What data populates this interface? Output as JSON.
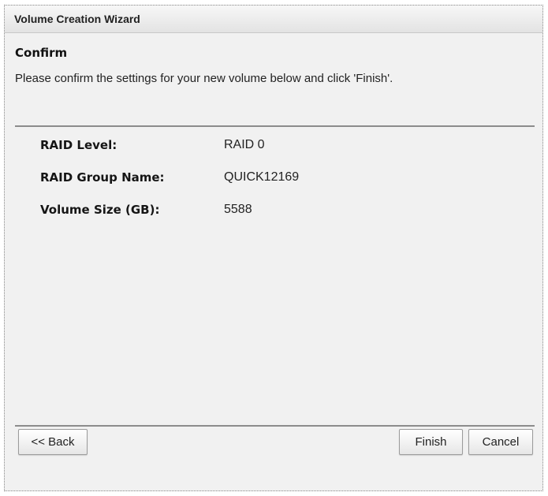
{
  "window": {
    "title": "Volume Creation Wizard"
  },
  "step": {
    "heading": "Confirm",
    "instruction": "Please confirm the settings for your new volume below and click 'Finish'."
  },
  "settings": [
    {
      "label": "RAID Level:",
      "value": "RAID 0"
    },
    {
      "label": "RAID Group Name:",
      "value": "QUICK12169"
    },
    {
      "label": "Volume Size (GB):",
      "value": "5588"
    }
  ],
  "buttons": {
    "back": "<< Back",
    "finish": "Finish",
    "cancel": "Cancel"
  }
}
